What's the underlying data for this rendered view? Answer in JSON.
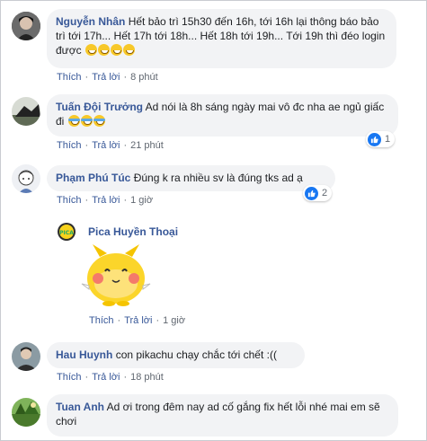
{
  "comments": [
    {
      "name": "Nguyễn Nhân",
      "text": "Hết bảo trì 15h30 đến 16h, tới 16h lại thông báo bảo trì tới 17h... Hết 17h tới 18h... Hết 18h tới 19h... Tới 19h thì đéo login được",
      "like": "Thích",
      "reply": "Trả lời",
      "time": "8 phút"
    },
    {
      "name": "Tuấn Đội Trưởng",
      "text": "Ad nói là 8h sáng ngày mai vô đc nha ae ngủ giấc đi",
      "like": "Thích",
      "reply": "Trả lời",
      "time": "21 phút",
      "reactions": "1"
    },
    {
      "name": "Phạm Phú Túc",
      "text": "Đúng k ra nhiều sv là đúng tks ad ạ",
      "like": "Thích",
      "reply": "Trả lời",
      "time": "1 giờ",
      "reactions": "2"
    },
    {
      "name": "Hau Huynh",
      "text": "con pikachu chạy chắc tới chết :((",
      "like": "Thích",
      "reply": "Trả lời",
      "time": "18 phút"
    },
    {
      "name": "Tuan Anh",
      "text": "Ad ơi trong đêm nay ad cố gắng fix hết lỗi nhé mai em sẽ chơi"
    }
  ],
  "reply": {
    "name": "Pica Huyền Thoại",
    "like": "Thích",
    "reply": "Trả lời",
    "time": "1 giờ"
  },
  "colors": {
    "name": "#385898",
    "bubble": "#f2f3f5",
    "meta": "#606770",
    "like_badge": "#1877f2"
  }
}
